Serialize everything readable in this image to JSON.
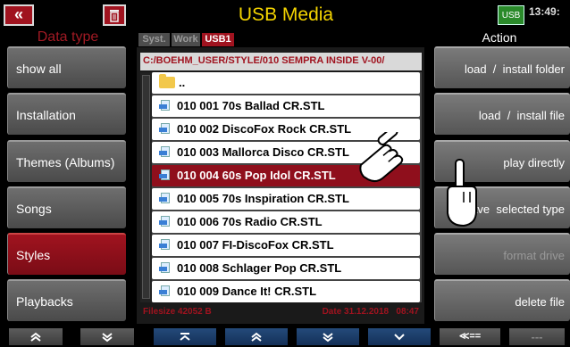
{
  "header": {
    "close_label": "«",
    "title": "USB Media",
    "usb_label": "USB",
    "clock": "13:49:"
  },
  "left": {
    "heading": "Data type",
    "items": [
      {
        "label": "show all",
        "active": false
      },
      {
        "label": "Installation",
        "active": false
      },
      {
        "label": "Themes (Albums)",
        "active": false
      },
      {
        "label": "Songs",
        "active": false
      },
      {
        "label": "Styles",
        "active": true
      },
      {
        "label": "Playbacks",
        "active": false
      }
    ]
  },
  "center": {
    "tabs": [
      {
        "label": "Syst.",
        "active": false
      },
      {
        "label": "Work",
        "active": false
      },
      {
        "label": "USB1",
        "active": true
      }
    ],
    "path": "C:/BOEHM_USER/STYLE/010 SEMPRA INSIDE V-00/",
    "parent_label": "..",
    "files": [
      "010 001 70s Ballad CR.STL",
      "010 002 DiscoFox Rock CR.STL",
      "010 003 Mallorca Disco CR.STL",
      "010 004 60s Pop Idol CR.STL",
      "010 005 70s Inspiration CR.STL",
      "010 006 70s Radio CR.STL",
      "010 007 FI-DiscoFox CR.STL",
      "010 008 Schlager Pop CR.STL",
      "010 009 Dance It! CR.STL"
    ],
    "selected_index": 3,
    "filesize": "Filesize 42052 B",
    "date": "Date 31.12.2018   08:47"
  },
  "right": {
    "heading": "Action",
    "items": [
      {
        "label": "load  /  install folder",
        "dim": false
      },
      {
        "label": "load  /  install file",
        "dim": false
      },
      {
        "label": "play directly",
        "dim": false
      },
      {
        "label": "save  selected type",
        "dim": false
      },
      {
        "label": "format drive",
        "dim": true
      },
      {
        "label": "delete file",
        "dim": false
      }
    ]
  },
  "footer": {
    "buttons": [
      "≪==",
      "---"
    ]
  },
  "colors": {
    "accent_red": "#a0131f",
    "title_yellow": "#f4d400",
    "nav_blue": "#1d3d6a"
  }
}
